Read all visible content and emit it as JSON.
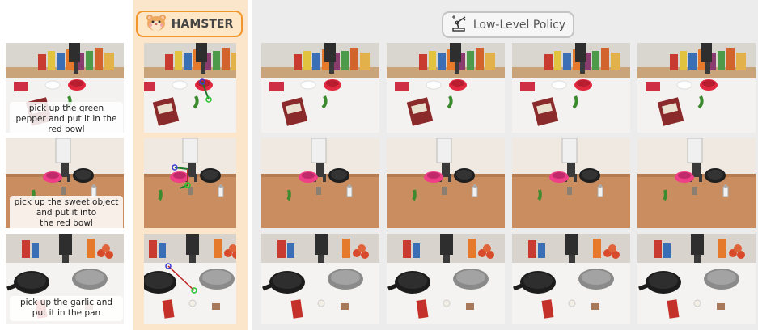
{
  "header": {
    "hamster_label": "HAMSTER",
    "policy_label": "Low-Level Policy"
  },
  "icons": {
    "hamster": "hamster-face-icon",
    "policy": "robot-arm-icon"
  },
  "colors": {
    "hamster_panel_bg": "#fbe6cc",
    "hamster_border": "#f0962a",
    "policy_panel_bg": "#ececec",
    "policy_border": "#c4c4c4"
  },
  "rows": [
    {
      "instruction": "pick up the green pepper and put it in the red bowl",
      "lines": [
        "pick up the green",
        "pepper and put it in the",
        "red bowl"
      ]
    },
    {
      "instruction": "pick up the sweet object and put it into the red bowl",
      "lines": [
        "pick up the sweet object",
        "and put it into",
        "the red bowl"
      ]
    },
    {
      "instruction": "pick up the garlic and put it in the pan",
      "lines": [
        "pick up the garlic and",
        "put it in the pan"
      ]
    }
  ]
}
